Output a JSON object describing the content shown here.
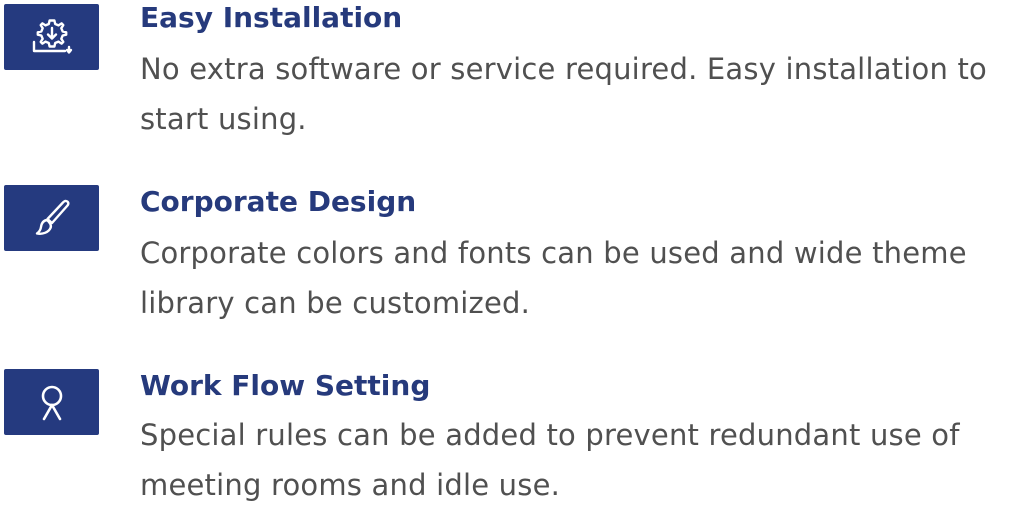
{
  "features": [
    {
      "title": "Easy Installation",
      "description": "No extra software or service required. Easy installation to start using.",
      "icon": "installation-gear-icon"
    },
    {
      "title": "Corporate Design",
      "description": "Corporate colors and fonts can be used and wide theme library can be customized.",
      "icon": "paintbrush-icon"
    },
    {
      "title": "Work Flow Setting",
      "description": "Special rules can be added to prevent redundant use of meeting rooms and idle use.",
      "icon": "workflow-location-icon"
    }
  ],
  "colors": {
    "accent": "#253a7f",
    "title": "#263a7c",
    "text": "#505050"
  }
}
